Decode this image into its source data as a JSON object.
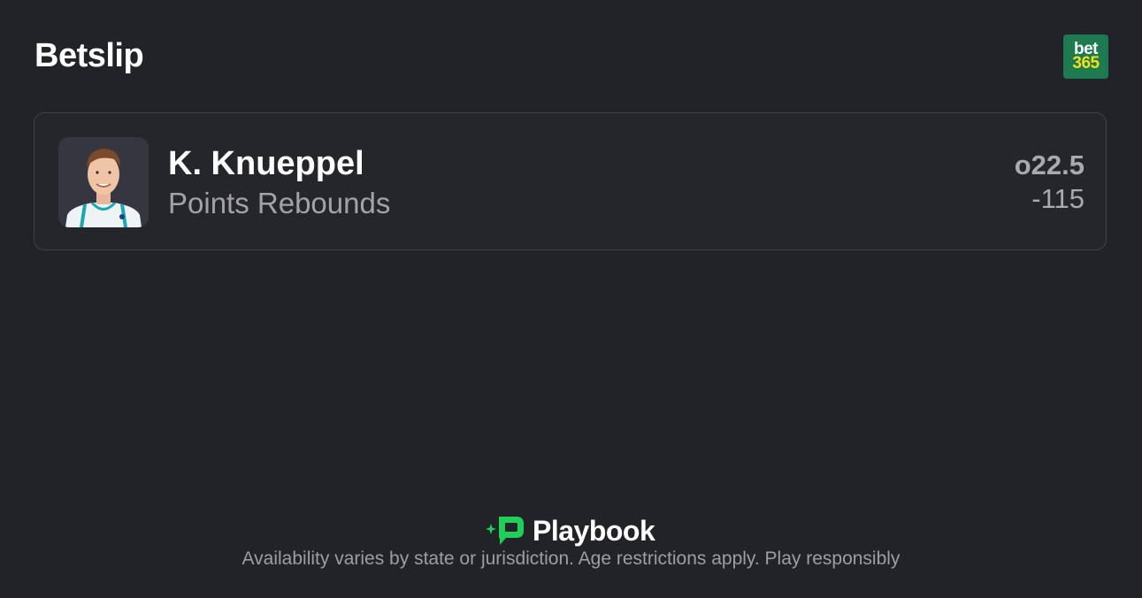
{
  "header": {
    "title": "Betslip",
    "book_logo": {
      "line1": "bet",
      "line2": "365",
      "bg": "#1e7a4f",
      "accent": "#f5df1a"
    }
  },
  "selection": {
    "player_name": "K. Knueppel",
    "market": "Points Rebounds",
    "line": "o22.5",
    "odds": "-115",
    "avatar_icon": "player-headshot-icon"
  },
  "footer": {
    "brand": "Playbook",
    "brand_icon": "playbook-logo-icon",
    "brand_color": "#1fcf5a",
    "disclaimer": "Availability varies by state or jurisdiction. Age restrictions apply. Play responsibly"
  }
}
